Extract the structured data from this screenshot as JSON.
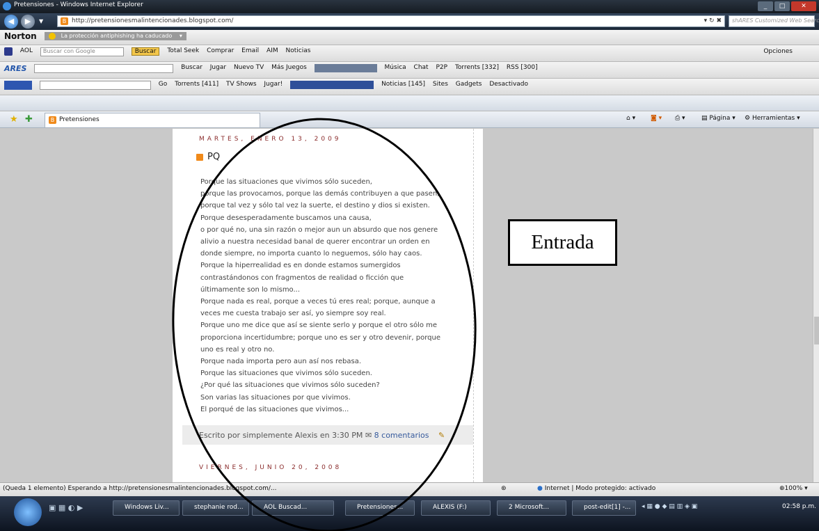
{
  "window": {
    "title": "Pretensiones - Windows Internet Explorer",
    "address": "http://pretensionesmalintencionades.blogspot.com/",
    "search_placeholder": "shARES Customized Web Search"
  },
  "toolbars": {
    "norton": {
      "brand": "Norton",
      "text": "La protección antiphishing ha caducado"
    },
    "aol": {
      "brand": "AOL",
      "search_label": "Buscar con Google",
      "buscar": "Buscar",
      "items": [
        "Total Seek",
        "Comprar",
        "Email",
        "AIM",
        "Noticias"
      ],
      "right": "Opciones"
    },
    "ares": {
      "brand": "ARES",
      "buscar": "Buscar",
      "items": [
        "Jugar",
        "Nuevo TV",
        "Más Juegos",
        "Música",
        "Chat",
        "P2P",
        "Torrents [332]",
        "RSS [300]"
      ]
    },
    "third": {
      "items": [
        "Go",
        "Torrents [411]",
        "TV Shows",
        "Jugar!",
        "Noticias [145]",
        "Sites",
        "Gadgets",
        "Desactivado"
      ]
    }
  },
  "tab": {
    "label": "Pretensiones"
  },
  "command_bar": {
    "pagina": "Página",
    "herramientas": "Herramientas"
  },
  "post": {
    "date_header": "MARTES, ENERO 13, 2009",
    "title": "PQ",
    "lines": [
      "Porque las situaciones que vivimos sólo suceden,",
      "porque las provocamos, porque las demás contribuyen a que pasen,",
      "porque tal vez y sólo tal vez la suerte, el destino y dios si existen.",
      "Porque desesperadamente buscamos una causa,",
      "o por qué no, una sin razón o mejor aun un absurdo que nos genere",
      "alivio a nuestra necesidad banal de querer encontrar un orden en",
      "donde siempre, no importa cuanto lo neguemos, sólo hay caos.",
      "Porque la hiperrealidad es en donde estamos sumergidos",
      "contrastándonos con fragmentos de realidad o ficción que",
      "últimamente son lo mismo...",
      "Porque nada es real, porque a veces tú eres real; porque, aunque a",
      "veces me cuesta trabajo ser así, yo siempre soy real.",
      "Porque uno me dice que así se siente serlo y porque el otro sólo me",
      "proporciona incertidumbre; porque uno es ser y otro devenir, porque",
      "uno es real y otro no.",
      "Porque nada importa pero aun así nos rebasa.",
      "Porque las situaciones que vivimos sólo suceden.",
      "¿Por qué las situaciones que vivimos sólo suceden?",
      "Son varias las situaciones por que vivimos.",
      "El porqué de las situaciones que vivimos..."
    ],
    "footer_prefix": "Escrito por simplemente Alexis en 3:30 PM",
    "comments": "8 comentarios",
    "next_date_header": "VIERNES, JUNIO 20, 2008"
  },
  "annotation": {
    "label": "Entrada"
  },
  "status": {
    "left": "(Queda 1 elemento) Esperando a http://pretensionesmalintencionades.blogspot.com/...",
    "zone": "Internet | Modo protegido: activado",
    "zoom": "100%"
  },
  "taskbar": {
    "items": [
      "Windows Liv...",
      "stephanie rod...",
      "AOL Buscad...",
      "Pretensiones...",
      "ALEXIS (F:)",
      "2 Microsoft...",
      "post-edit[1] -..."
    ],
    "clock": "02:58 p.m."
  },
  "colors": {
    "accent": "#f08a1a",
    "date": "#8a2b2b",
    "link": "#365a9c"
  }
}
